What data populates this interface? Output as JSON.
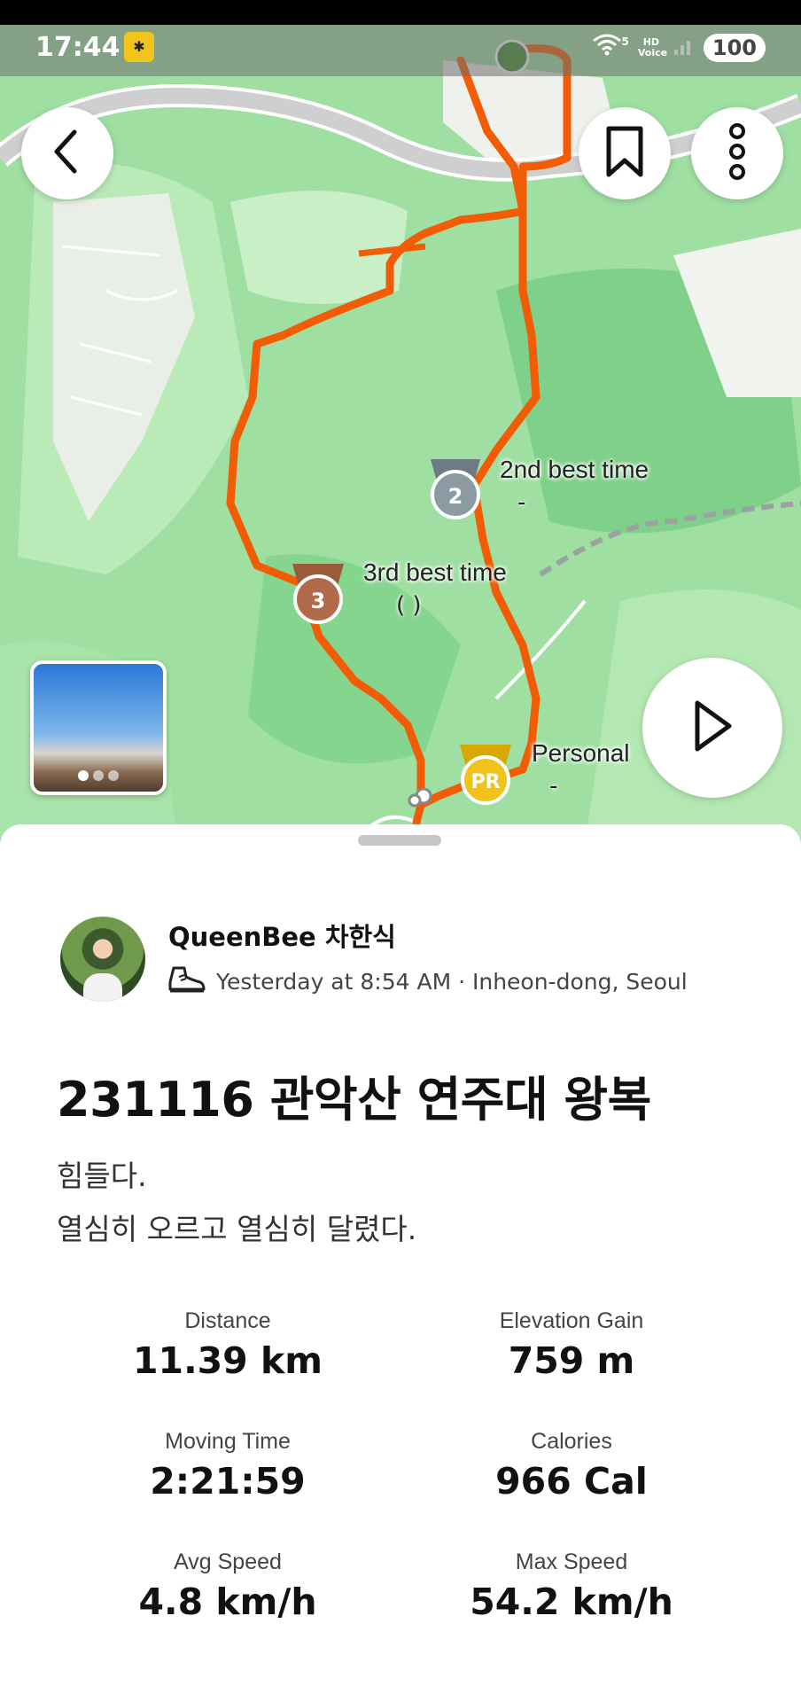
{
  "status_bar": {
    "time": "17:44",
    "network": "5",
    "hd_voice": "HD Voice",
    "battery": "100"
  },
  "map": {
    "markers": [
      {
        "label": "2nd best time",
        "sub": "-",
        "badge": "2"
      },
      {
        "label": "3rd best time",
        "sub": "( )",
        "badge": "3"
      },
      {
        "label": "Personal",
        "sub": "-",
        "badge": "PR"
      }
    ],
    "colors": {
      "route": "#f25c05",
      "park": "#9fe0a4",
      "road": "#c9c9c9"
    }
  },
  "actions": {
    "back_icon": "chevron-left-icon",
    "bookmark_icon": "bookmark-icon",
    "more_icon": "more-vertical-icon",
    "play_icon": "play-icon"
  },
  "activity": {
    "username": "QueenBee 차한식",
    "meta": "Yesterday at 8:54 AM · Inheon-dong, Seoul",
    "title": "231116 관악산 연주대 왕복",
    "description": [
      "힘들다.",
      "열심히 오르고 열심히 달렸다."
    ]
  },
  "stats": [
    {
      "label": "Distance",
      "value": "11.39 km"
    },
    {
      "label": "Elevation Gain",
      "value": "759 m"
    },
    {
      "label": "Moving Time",
      "value": "2:21:59"
    },
    {
      "label": "Calories",
      "value": "966 Cal"
    },
    {
      "label": "Avg Speed",
      "value": "4.8 km/h"
    },
    {
      "label": "Max Speed",
      "value": "54.2 km/h"
    }
  ]
}
